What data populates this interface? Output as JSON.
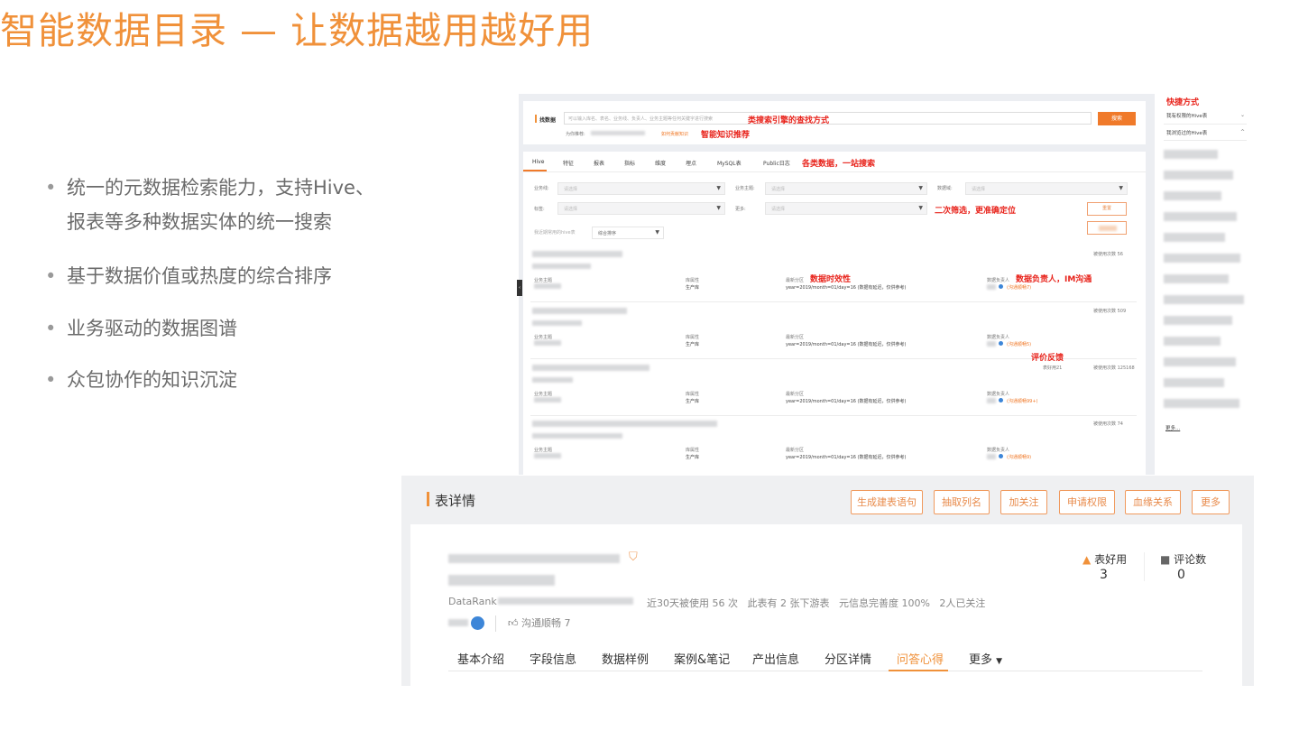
{
  "title": "智能数据目录 — 让数据越用越好用",
  "bullets": [
    "统一的元数据检索能力，支持Hive、",
    "报表等多种数据实体的统一搜索",
    "基于数据价值或热度的综合排序",
    "业务驱动的数据图谱",
    "众包协作的知识沉淀"
  ],
  "search": {
    "label": "找数据",
    "placeholder": "可以输入库名、表名、业务线、负责人、业务主题等任何关键字进行搜索",
    "button": "搜索",
    "recommend_label": "为你推荐:",
    "recommend_link": "如何贡献知识"
  },
  "tabs": [
    "Hive",
    "特征",
    "报表",
    "指标",
    "维度",
    "埋点",
    "MySQL表",
    "Public日志"
  ],
  "filters": {
    "business_line": "业务线:",
    "business_topic": "业务主题:",
    "data_domain": "数据域:",
    "tag": "标签:",
    "more": "更多:",
    "placeholder": "请选择",
    "reset": "重置",
    "sort_label": "我近期常用的hive表",
    "sort_value": "综合排序"
  },
  "annotations": {
    "search_engine": "类搜索引擎的查找方式",
    "smart_recommend": "智能知识推荐",
    "one_stop": "各类数据，一站搜索",
    "secondary_filter": "二次筛选，更准确定位",
    "timeliness": "数据时效性",
    "owner": "数据负责人，IM沟通",
    "feedback": "评价反馈",
    "shortcut": "快捷方式"
  },
  "results": [
    {
      "usage": "被使用次数 56",
      "feedback": "(沟通顺畅7)"
    },
    {
      "usage": "被使用次数 509",
      "feedback": "(沟通顺畅5)"
    },
    {
      "usage": "被使用次数 125168",
      "good": "表好用21",
      "feedback": "(沟通顺畅99+)"
    },
    {
      "usage": "被使用次数 74",
      "feedback": "(沟通顺畅9)"
    }
  ],
  "result_labels": {
    "topic": "业务主题",
    "db_attr": "库属性",
    "db_value": "生产库",
    "partition": "最新分区",
    "partition_value": "year=2019/month=01/day=16 (数据有延迟，仅供参考)",
    "owner": "数据负责人"
  },
  "sidebar": {
    "items": [
      "我有权限的Hive表",
      "我浏览过的Hive表"
    ],
    "more": "更多..."
  },
  "detail": {
    "header": "表详情",
    "buttons": [
      "生成建表语句",
      "抽取列名",
      "加关注",
      "申请权限",
      "血缘关系",
      "更多"
    ],
    "datarank": "DataRank",
    "stats": "近30天被使用 56 次   此表有 2 张下游表   元信息完善度 100%   2人已关注",
    "communication": "沟通顺畅 7",
    "good_label": "表好用",
    "good_count": "3",
    "comment_label": "评论数",
    "comment_count": "0",
    "tabs": [
      "基本介绍",
      "字段信息",
      "数据样例",
      "案例&笔记",
      "产出信息",
      "分区详情",
      "问答心得",
      "更多"
    ]
  },
  "colors": {
    "accent": "#f0913a",
    "annotation": "#e8231b"
  }
}
